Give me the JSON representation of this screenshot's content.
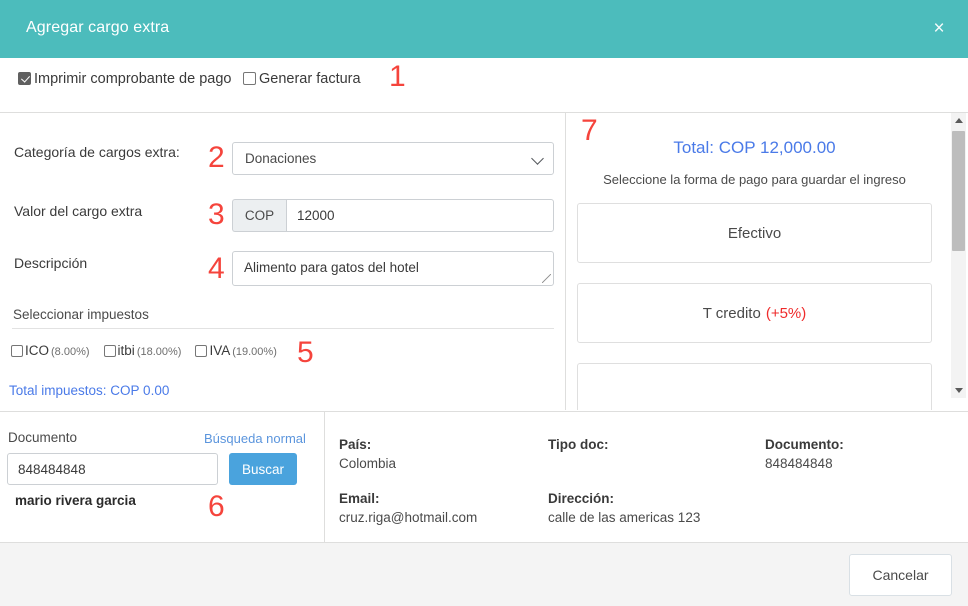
{
  "header": {
    "title": "Agregar cargo extra",
    "close_label": "×",
    "bg_color": "#4cbcbc"
  },
  "options": [
    {
      "label": "Imprimir comprobante de pago",
      "checked": true
    },
    {
      "label": "Generar factura",
      "checked": false
    }
  ],
  "form": {
    "category_label": "Categoría de cargos extra:",
    "category_value": "Donaciones",
    "amount_label": "Valor del cargo extra",
    "currency_addon": "COP",
    "amount_value": "12000",
    "description_label": "Descripción",
    "description_value": "Alimento para gatos del hotel"
  },
  "taxes": {
    "section_title": "Seleccionar impuestos",
    "items": [
      {
        "name": "ICO",
        "rate": "(8.00%)",
        "checked": false
      },
      {
        "name": "itbi",
        "rate": "(18.00%)",
        "checked": false
      },
      {
        "name": "IVA",
        "rate": "(19.00%)",
        "checked": false
      }
    ],
    "total_label": "Total impuestos: COP 0.00"
  },
  "payment": {
    "total_label": "Total: COP 12,000.00",
    "instruction": "Seleccione la forma de pago para guardar el ingreso",
    "methods": [
      {
        "label": "Efectivo",
        "surcharge": ""
      },
      {
        "label": "T credito",
        "surcharge": "(+5%)"
      },
      {
        "label": "",
        "surcharge": ""
      }
    ]
  },
  "customer": {
    "document_label": "Documento",
    "search_mode_label": "Búsqueda normal",
    "document_value": "848484848",
    "search_button": "Buscar",
    "name": "mario rivera garcia",
    "info": [
      {
        "key": "País:",
        "value": "Colombia"
      },
      {
        "key": "Tipo doc:",
        "value": ""
      },
      {
        "key": "Documento:",
        "value": "848484848"
      },
      {
        "key": "Email:",
        "value": "cruz.riga@hotmail.com"
      },
      {
        "key": "Dirección:",
        "value": "calle de las americas 123"
      }
    ]
  },
  "footer": {
    "cancel_label": "Cancelar"
  },
  "annotations": [
    {
      "n": "1"
    },
    {
      "n": "2"
    },
    {
      "n": "3"
    },
    {
      "n": "4"
    },
    {
      "n": "5"
    },
    {
      "n": "6"
    },
    {
      "n": "7"
    }
  ],
  "colors": {
    "accent_teal": "#4cbcbc",
    "link_blue": "#4a7ae8",
    "button_blue": "#4aa3dd",
    "annotation_red": "#f5443c",
    "surcharge_red": "#ef2b2b"
  }
}
